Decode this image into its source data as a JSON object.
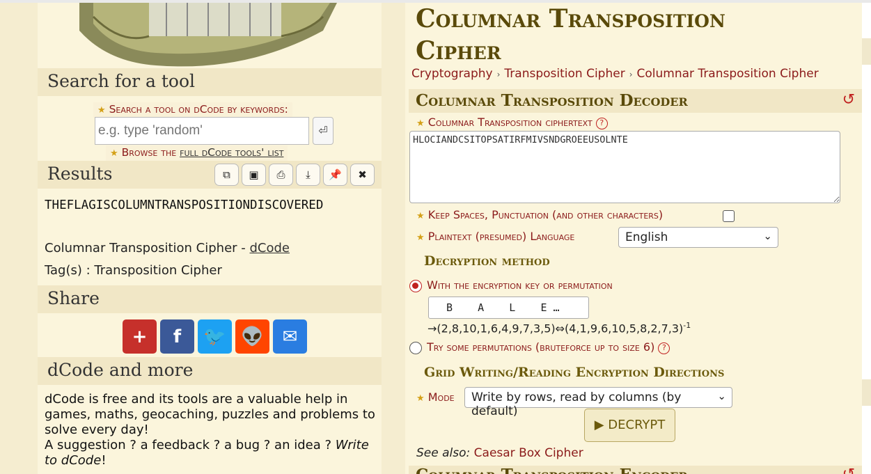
{
  "left": {
    "search": {
      "title": "Search for a tool",
      "label": "Search a tool on dCode by keywords:",
      "placeholder": "e.g. type 'random'",
      "go_icon": "⏎",
      "browse_prefix": "Browse the ",
      "browse_link": "full dCode tools' list"
    },
    "results": {
      "title": "Results",
      "toolbar": [
        {
          "name": "copy-icon",
          "glyph": "⧉"
        },
        {
          "name": "archive-icon",
          "glyph": "▣"
        },
        {
          "name": "print-icon",
          "glyph": "⎙"
        },
        {
          "name": "download-icon",
          "glyph": "⤓"
        },
        {
          "name": "pin-icon",
          "glyph": "📌"
        },
        {
          "name": "close-icon",
          "glyph": "✖"
        }
      ],
      "output": "THEFLAGISCOLUMNTRANSPOSITIONDISCOVERED",
      "credit_text": "Columnar Transposition Cipher - ",
      "credit_link": "dCode",
      "tags": "Tag(s) : Transposition Cipher"
    },
    "share": {
      "title": "Share",
      "buttons": [
        {
          "name": "share-more-button",
          "glyph": "+",
          "color": "#c6302b"
        },
        {
          "name": "facebook-button",
          "glyph": "f",
          "color": "#3b5998"
        },
        {
          "name": "twitter-button",
          "glyph": "🐦",
          "color": "#1da1f2"
        },
        {
          "name": "reddit-button",
          "glyph": "👽",
          "color": "#ff4500"
        },
        {
          "name": "email-button",
          "glyph": "✉",
          "color": "#2a7de1"
        }
      ]
    },
    "more": {
      "title": "dCode and more",
      "text1": "dCode is free and its tools are a valuable help in games, maths, geocaching, puzzles and problems to solve every day!",
      "text2": "A suggestion ? a feedback ? a bug ? an idea ? ",
      "link": "Write to dCode",
      "end": "!"
    }
  },
  "main": {
    "title": "Columnar Transposition Cipher",
    "breadcrumbs": [
      "Cryptography",
      "Transposition Cipher",
      "Columnar Transposition Cipher"
    ],
    "decoder": {
      "title": "Columnar Transposition Decoder",
      "reset_icon": "↺",
      "ciphertext_label": "Columnar Transposition ciphertext",
      "ciphertext": "HLOCIANDCSITOPSATIRFMIVSNDGROEEUSOLNTE",
      "keep_label": "Keep Spaces, Punctuation (and other characters)",
      "keep_checked": false,
      "language_label": "Plaintext (presumed) Language",
      "language": "English",
      "method_title": "Decryption method",
      "option1": "With the encryption key or permutation",
      "key_value": "B    A    L    E …",
      "perm_text": "→(2,8,10,1,6,4,9,7,3,5)⇔(4,1,9,6,10,5,8,2,7,3)",
      "perm_sup": "-1",
      "option2": "Try some permutations (bruteforce up to size 6)",
      "grid_title": "Grid Writing/Reading Encryption Directions",
      "mode_label": "Mode",
      "mode_value": "Write by rows, read by columns (by default)",
      "decrypt_label": "▶ DECRYPT",
      "see_also_label": "See also:",
      "see_also_link": "Caesar Box Cipher"
    },
    "encoder": {
      "title": "Columnar Transposition Encoder"
    }
  }
}
